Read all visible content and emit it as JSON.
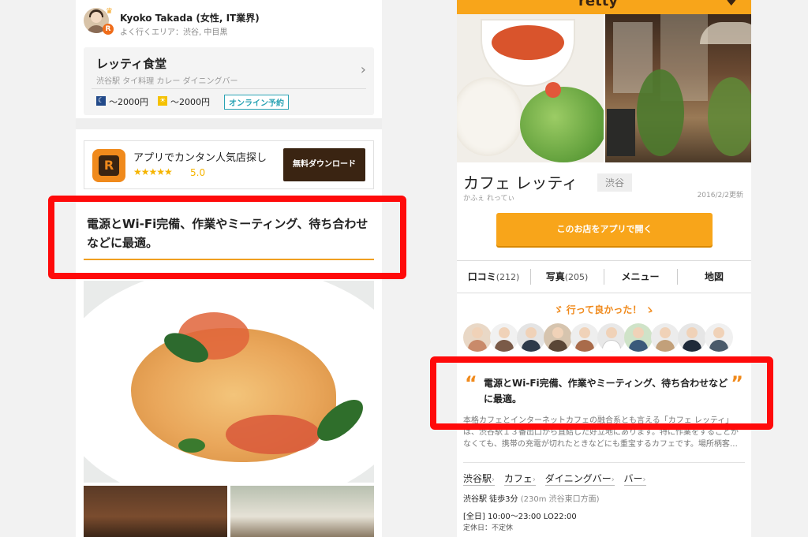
{
  "left": {
    "user": {
      "name": "Kyoko Takada (女性, IT業界)",
      "area": "よく行くエリア：渋谷, 中目黒",
      "crown_icon": "crown-icon",
      "badge_letter": "R"
    },
    "shop": {
      "name": "レッティ食堂",
      "category": "渋谷駅 タイ料理 カレー ダイニングバー",
      "price_night": "〜2000円",
      "price_lunch": "〜2000円",
      "online_reserve": "オンライン予約",
      "chevron": "›"
    },
    "app_banner": {
      "title": "アプリでカンタン人気店探し",
      "stars": "★★★★★",
      "rating": "5.0",
      "download": "無料ダウンロード",
      "icon_letter": "R"
    },
    "headline": "電源とWi-Fi完備、作業やミーティング、待ち合わせなどに最適。"
  },
  "right": {
    "header": {
      "logo": "retty",
      "menu_icon": "heart-icon"
    },
    "shop": {
      "name": "カフェ レッティ",
      "kana": "かふぇ れってぃ",
      "area": "渋谷",
      "updated": "2016/2/2更新"
    },
    "open_app_button": "このお店をアプリで開く",
    "tabs": [
      {
        "label": "口コミ",
        "count": "(212)"
      },
      {
        "label": "写真",
        "count": "(205)"
      },
      {
        "label": "メニュー",
        "count": ""
      },
      {
        "label": "地図",
        "count": ""
      }
    ],
    "went_good": "行って良かった！",
    "quote_open": "“",
    "quote_close": "”",
    "headline": "電源とWi-Fi完備、作業やミーティング、待ち合わせなどに最適。",
    "description": "本格カフェとインターネットカフェの融合系とも言える「カフェ レッティ」は、渋谷駅１３番出口から直結した好立地にあります。特に作業をすることがなくても、携帯の充電が切れたときなどにも重宝するカフェです。場所柄客…",
    "tags": [
      "渋谷駅",
      "カフェ",
      "ダイニングバー",
      "バー"
    ],
    "access_main": "渋谷駅 徒歩3分",
    "access_sub": "(230m 渋谷東口方面)",
    "hours": "[全日] 10:00〜23:00 LO22:00",
    "holiday": "定休日：不定休"
  },
  "colors": {
    "brand_orange": "#f8a51a",
    "annotation_red": "#ff0a0a",
    "reserve_teal": "#2aa3b4",
    "dark_brown": "#3a2412"
  }
}
